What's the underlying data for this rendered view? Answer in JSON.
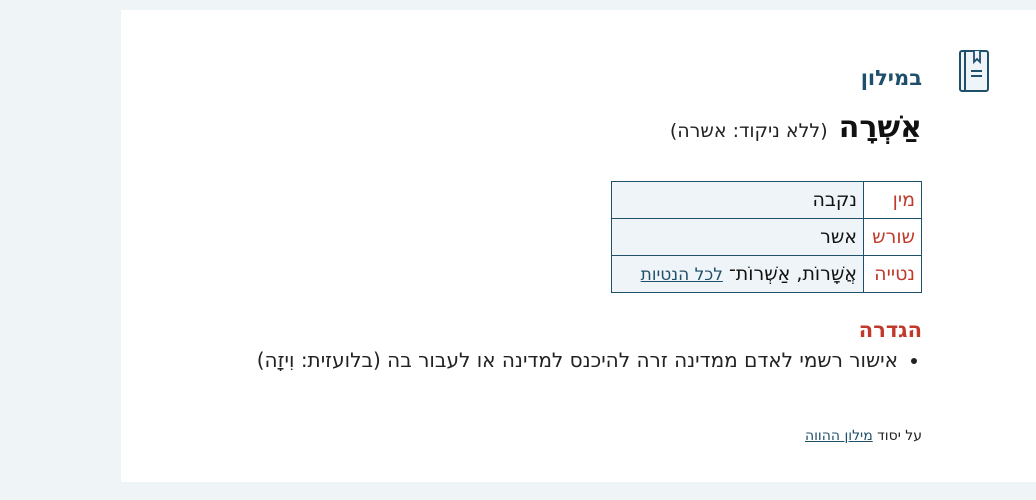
{
  "panel": {
    "title": "במילון",
    "icon": "dictionary-book-icon"
  },
  "entry": {
    "headword": "אַשְׁרָה",
    "no_nikud": "(ללא ניקוד: אשרה)"
  },
  "info_table": [
    {
      "label": "מין",
      "value": "נקבה"
    },
    {
      "label": "שורש",
      "value": "אשר"
    },
    {
      "label": "נטייה",
      "value": "אֲשָׁרוֹת, אַשְׁרוֹת־",
      "link": "לכל הנטיות"
    }
  ],
  "definition": {
    "title": "הגדרה",
    "items": [
      "אישור רשמי לאדם ממדינה זרה להיכנס למדינה או לעבור בה (בלועזית: וִיזָה)"
    ]
  },
  "source": {
    "prefix": "על יסוד",
    "link": "מילון ההווה"
  },
  "colors": {
    "accent": "#1e4f6b",
    "label_red": "#c0392b",
    "background": "#eff4f6"
  }
}
